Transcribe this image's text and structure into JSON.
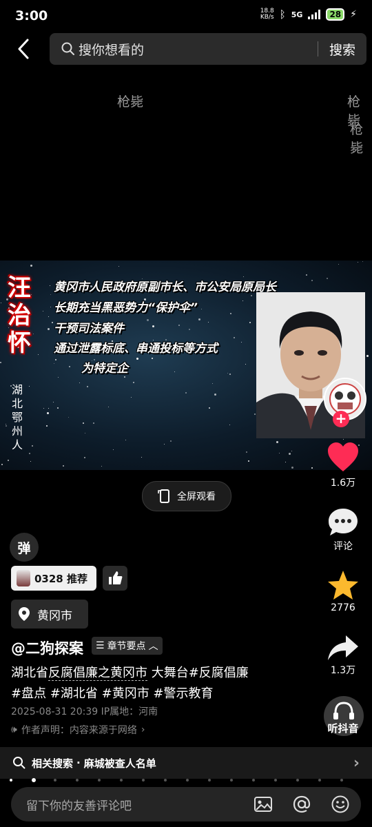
{
  "status_bar": {
    "time": "3:00",
    "net_speed": "18.8",
    "net_unit": "KB/s",
    "network": "5G",
    "battery": "28"
  },
  "search": {
    "placeholder": "搜你想看的",
    "button_label": "搜索"
  },
  "danmaku": [
    "枪毙",
    "枪毙",
    "枪毙"
  ],
  "video": {
    "title_name": "汪治怀",
    "origin": "湖北鄂州人",
    "lines": [
      "黄冈市人民政府原副市长、市公安局原局长",
      "长期充当黑恶势力“保护伞”",
      "干预司法案件",
      "通过泄露标底、串通投标等方式",
      "为特定企"
    ]
  },
  "fullscreen_label": "全屏观看",
  "rail": {
    "likes": "1.6万",
    "comments_label": "评论",
    "favorites": "2776",
    "shares": "1.3万",
    "listen_label": "听抖音"
  },
  "danmu_toggle": "弹",
  "recommend": {
    "label": "0328 推荐"
  },
  "location": "黄冈市",
  "author": "@二狗探案",
  "chapter_label": "章节要点",
  "description": {
    "text1": "湖北省",
    "underlined": "反腐倡廉之黄冈市",
    "text2": " 大舞台#反腐倡廉",
    "line2": "#盘点 #湖北省 #黄冈市 #警示教育"
  },
  "meta": "2025-08-31 20:39 IP属地：河南",
  "claim": "作者声明：内容来源于网络",
  "related": {
    "prefix": "相关搜索",
    "query": "麻城被查人名单"
  },
  "comment_placeholder": "留下你的友善评论吧",
  "colors": {
    "accent_red": "#fe2c55",
    "star_yellow": "#fcb92e"
  }
}
